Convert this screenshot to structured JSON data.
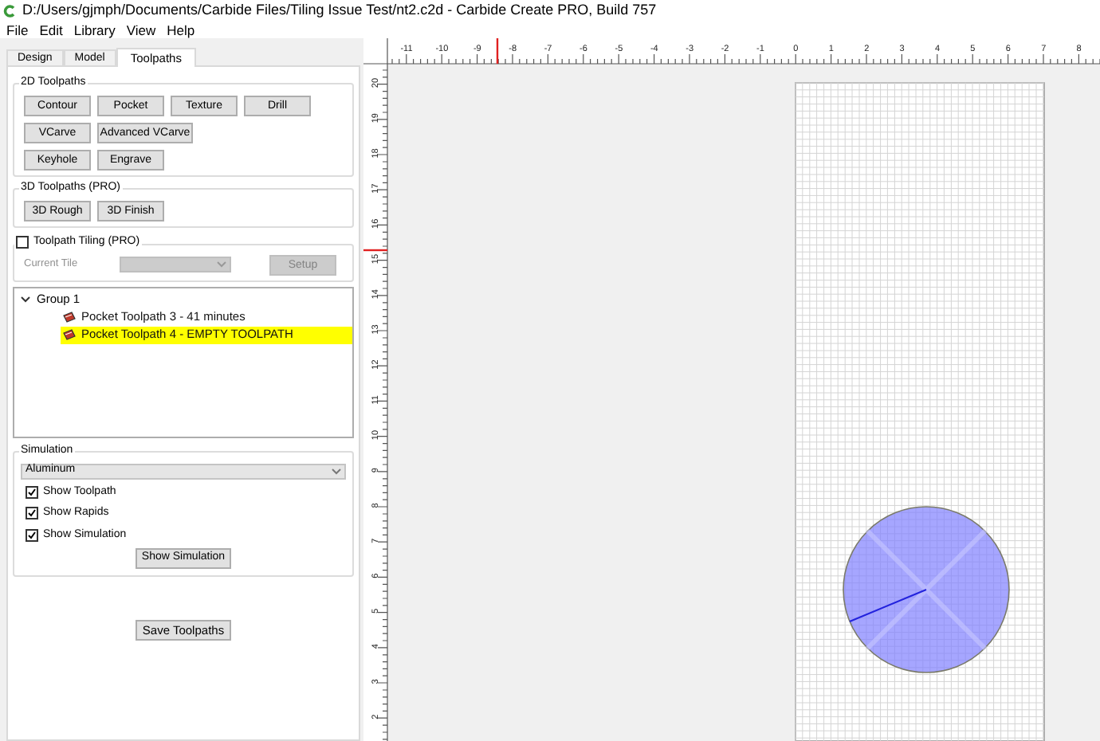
{
  "window": {
    "title": "D:/Users/gjmph/Documents/Carbide Files/Tiling Issue Test/nt2.c2d - Carbide Create PRO, Build 757"
  },
  "menu": [
    "File",
    "Edit",
    "Library",
    "View",
    "Help"
  ],
  "tabs": [
    {
      "label": "Design",
      "selected": false
    },
    {
      "label": "Model",
      "selected": false
    },
    {
      "label": "Toolpaths",
      "selected": true
    }
  ],
  "toolpaths_2d": {
    "title": "2D Toolpaths",
    "buttons": [
      [
        "Contour",
        "Pocket",
        "Texture",
        "Drill"
      ],
      [
        "VCarve",
        "Advanced VCarve"
      ],
      [
        "Keyhole",
        "Engrave"
      ]
    ]
  },
  "toolpaths_3d": {
    "title": "3D Toolpaths (PRO)",
    "buttons": [
      "3D Rough",
      "3D Finish"
    ]
  },
  "tiling": {
    "label": "Toolpath Tiling (PRO)",
    "checked": false,
    "current_tile_label": "Current Tile",
    "setup_button": "Setup",
    "disabled": true
  },
  "toolpath_tree": [
    {
      "label": "Group 1",
      "expanded": true,
      "children": [
        {
          "label": "Pocket Toolpath 3 - 41 minutes",
          "selected": false
        },
        {
          "label": "Pocket Toolpath 4 - EMPTY TOOLPATH",
          "selected": true
        }
      ]
    }
  ],
  "simulation": {
    "title": "Simulation",
    "material": "Aluminum",
    "options": [
      {
        "label": "Show Toolpath",
        "checked": true
      },
      {
        "label": "Show Rapids",
        "checked": true
      },
      {
        "label": "Show Simulation",
        "checked": true
      }
    ],
    "button": "Show Simulation"
  },
  "save_button": "Save Toolpaths",
  "ruler": {
    "x_labels": [
      "-11",
      "-10",
      "-9",
      "-8",
      "-7",
      "-6",
      "-5",
      "-4",
      "-3",
      "-2",
      "-1",
      "0",
      "1",
      "2",
      "3",
      "4",
      "5",
      "6",
      "7",
      "8"
    ],
    "y_labels": [
      "20",
      "19",
      "18",
      "17",
      "16",
      "15",
      "14",
      "13",
      "12",
      "11",
      "10",
      "9",
      "8",
      "7",
      "6",
      "5",
      "4",
      "3",
      "2"
    ]
  }
}
